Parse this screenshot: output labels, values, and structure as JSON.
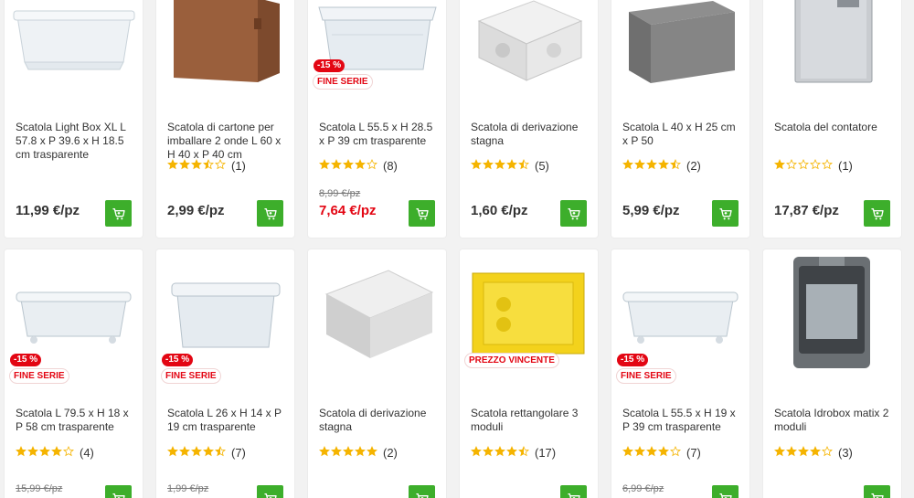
{
  "colors": {
    "accent": "#3dae2b",
    "sale": "#e30613",
    "star": "#f5b400"
  },
  "row1": [
    {
      "title": "Scatola Light Box XL L 57.8 x P 39.6 x H 18.5 cm trasparente",
      "price": "11,99 €/pz",
      "old_price": "",
      "discount": "",
      "tag": "",
      "rating": "",
      "reviews": "",
      "image": "transparent-storage-box"
    },
    {
      "title": "Scatola di cartone per imballare 2 onde L 60 x H 40 x P 40 cm",
      "price": "2,99 €/pz",
      "old_price": "",
      "discount": "",
      "tag": "",
      "rating": 3.5,
      "reviews": "(1)",
      "image": "cardboard-box"
    },
    {
      "title": "Scatola L 55.5 x H 28.5 x P 39 cm trasparente",
      "price": "7,64 €/pz",
      "old_price": "8,99 €/pz",
      "discount": "-15 %",
      "tag": "FINE SERIE",
      "rating": 4,
      "reviews": "(8)",
      "image": "transparent-box-lid"
    },
    {
      "title": "Scatola di derivazione stagna",
      "price": "1,60 €/pz",
      "old_price": "",
      "discount": "",
      "tag": "",
      "rating": 4.5,
      "reviews": "(5)",
      "image": "junction-box"
    },
    {
      "title": "Scatola L 40 x H 25 cm x P 50",
      "price": "5,99 €/pz",
      "old_price": "",
      "discount": "",
      "tag": "",
      "rating": 4.5,
      "reviews": "(2)",
      "image": "grey-fabric-box"
    },
    {
      "title": "Scatola del contatore",
      "price": "17,87 €/pz",
      "old_price": "",
      "discount": "",
      "tag": "",
      "rating": 1,
      "reviews": "(1)",
      "image": "meter-box"
    }
  ],
  "row2": [
    {
      "title": "Scatola L 79.5 x H 18 x P 58 cm trasparente",
      "price": "",
      "old_price": "15,99 €/pz",
      "discount": "-15 %",
      "tag": "FINE SERIE",
      "rating": 4,
      "reviews": "(4)",
      "image": "flat-transparent-box"
    },
    {
      "title": "Scatola L 26 x H 14 x P 19 cm trasparente",
      "price": "",
      "old_price": "1,99 €/pz",
      "discount": "-15 %",
      "tag": "FINE SERIE",
      "rating": 4.5,
      "reviews": "(7)",
      "image": "small-transparent-box"
    },
    {
      "title": "Scatola di derivazione stagna",
      "price": "",
      "old_price": "",
      "discount": "",
      "tag": "",
      "rating": 5,
      "reviews": "(2)",
      "image": "grey-junction-box"
    },
    {
      "title": "Scatola rettangolare 3 moduli",
      "price": "",
      "old_price": "",
      "discount": "",
      "tag": "PREZZO VINCENTE",
      "rating": 4.5,
      "reviews": "(17)",
      "image": "yellow-flush-box"
    },
    {
      "title": "Scatola L 55.5 x H 19 x P 39 cm trasparente",
      "price": "",
      "old_price": "6,99 €/pz",
      "discount": "-15 %",
      "tag": "FINE SERIE",
      "rating": 4,
      "reviews": "(7)",
      "image": "flat-transparent-box"
    },
    {
      "title": "Scatola Idrobox matix 2 moduli",
      "price": "",
      "old_price": "",
      "discount": "",
      "tag": "",
      "rating": 4,
      "reviews": "(3)",
      "image": "idrobox"
    }
  ]
}
